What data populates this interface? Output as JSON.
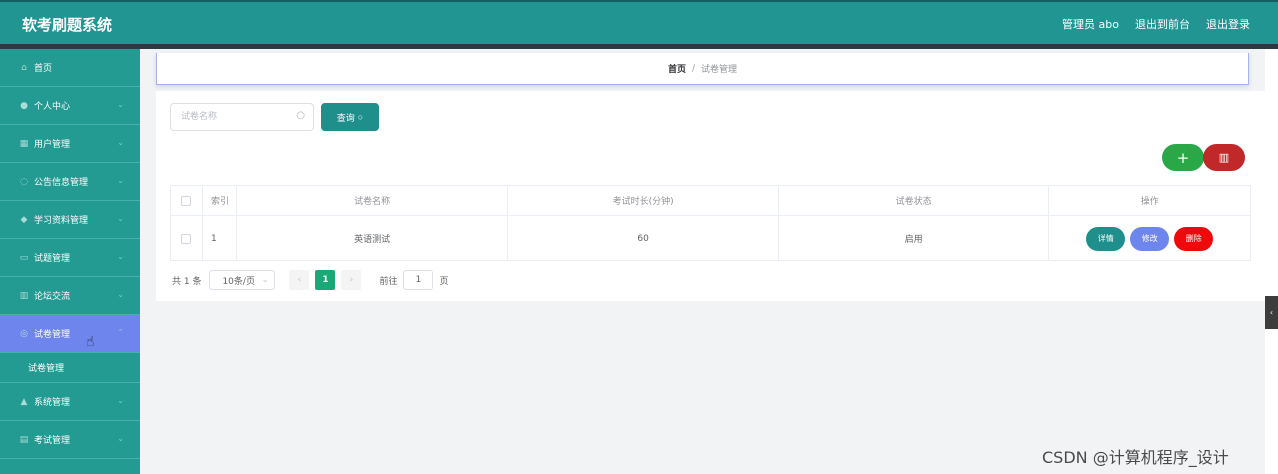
{
  "header": {
    "brand": "软考刷题系统",
    "links": [
      "管理员 abo",
      "退出到前台",
      "退出登录"
    ]
  },
  "sidebar": {
    "items": [
      {
        "label": "首页",
        "icon": "home-icon",
        "glyph": "⌂"
      },
      {
        "label": "个人中心",
        "icon": "user-icon",
        "glyph": "●"
      },
      {
        "label": "用户管理",
        "icon": "users-icon",
        "glyph": "▦"
      },
      {
        "label": "公告信息管理",
        "icon": "bell-icon",
        "glyph": "◌"
      },
      {
        "label": "学习资料管理",
        "icon": "book-icon",
        "glyph": "◆"
      },
      {
        "label": "试题管理",
        "icon": "question-icon",
        "glyph": "▭"
      },
      {
        "label": "论坛交流",
        "icon": "forum-icon",
        "glyph": "▥"
      },
      {
        "label": "试卷管理",
        "icon": "paper-icon",
        "glyph": "◎"
      },
      {
        "label": "系统管理",
        "icon": "settings-icon",
        "glyph": "▲"
      },
      {
        "label": "考试管理",
        "icon": "exam-icon",
        "glyph": "▤"
      }
    ],
    "submenu_label": "试卷管理"
  },
  "breadcrumb": {
    "home": "首页",
    "sep": "/",
    "current": "试卷管理"
  },
  "search": {
    "placeholder": "试卷名称",
    "button": "查询"
  },
  "table": {
    "headers": [
      "索引",
      "试卷名称",
      "考试时长(分钟)",
      "试卷状态",
      "操作"
    ],
    "rows": [
      {
        "index": "1",
        "name": "英语测试",
        "duration": "60",
        "status": "启用"
      }
    ],
    "actions": {
      "detail": "详情",
      "edit": "修改",
      "delete": "删除"
    }
  },
  "pagination": {
    "total": "共 1 条",
    "page_size": "10条/页",
    "current_page": "1",
    "goto_label": "前往",
    "goto_value": "1",
    "page_unit": "页"
  },
  "watermark": "CSDN @计算机程序_设计",
  "colors": {
    "teal": "#219592",
    "active": "#6f85ee",
    "add": "#2aa746",
    "delete": "#c0282a"
  }
}
